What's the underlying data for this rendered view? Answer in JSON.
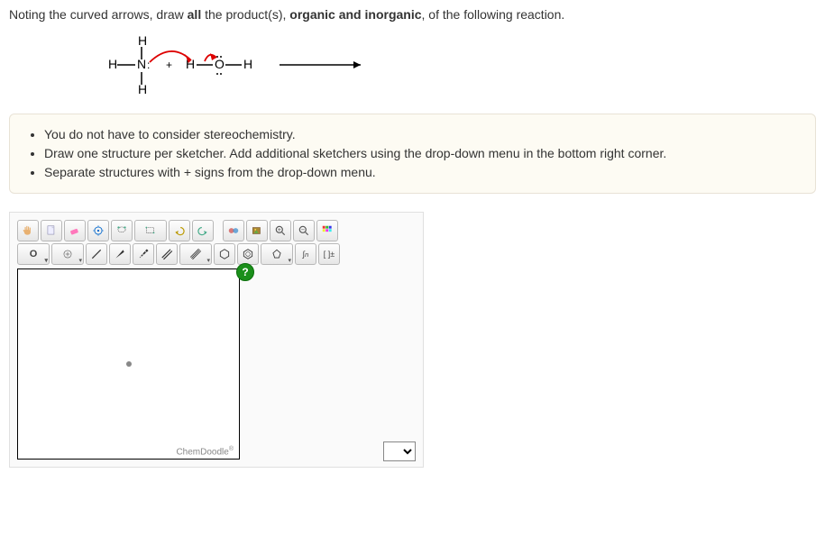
{
  "question": {
    "prefix": "Noting the curved arrows, draw ",
    "bold1": "all",
    "mid": " the product(s), ",
    "bold2": "organic and inorganic",
    "suffix": ", of the following reaction."
  },
  "reaction": {
    "left_structure_label": "H-N(H)(H):",
    "plus": "+",
    "right_structure_label": "H-O(:)-H",
    "arrow": "→"
  },
  "hints": [
    "You do not have to consider stereochemistry.",
    "Draw one structure per sketcher. Add additional sketchers using the drop-down menu in the bottom right corner.",
    "Separate structures with + signs from the drop-down menu."
  ],
  "toolbar": {
    "row1": [
      "hand",
      "file",
      "erase",
      "center",
      "lasso",
      "marquee",
      "undo",
      "redo",
      "view3d",
      "copy",
      "zoom-in",
      "zoom-out",
      "color"
    ],
    "row2": [
      "element-O",
      "add-atom",
      "bond-single",
      "bond-wedge",
      "bond-dashed",
      "bond-double",
      "bond-triple",
      "ring-hex",
      "ring-benzene",
      "ring-other",
      "chain",
      "charge-bracket"
    ]
  },
  "labels": {
    "element_O": "O",
    "help": "?",
    "chemdoodle": "ChemDoodle",
    "reg": "®",
    "bracket_label": "[ ]±",
    "chain_label": "n"
  }
}
